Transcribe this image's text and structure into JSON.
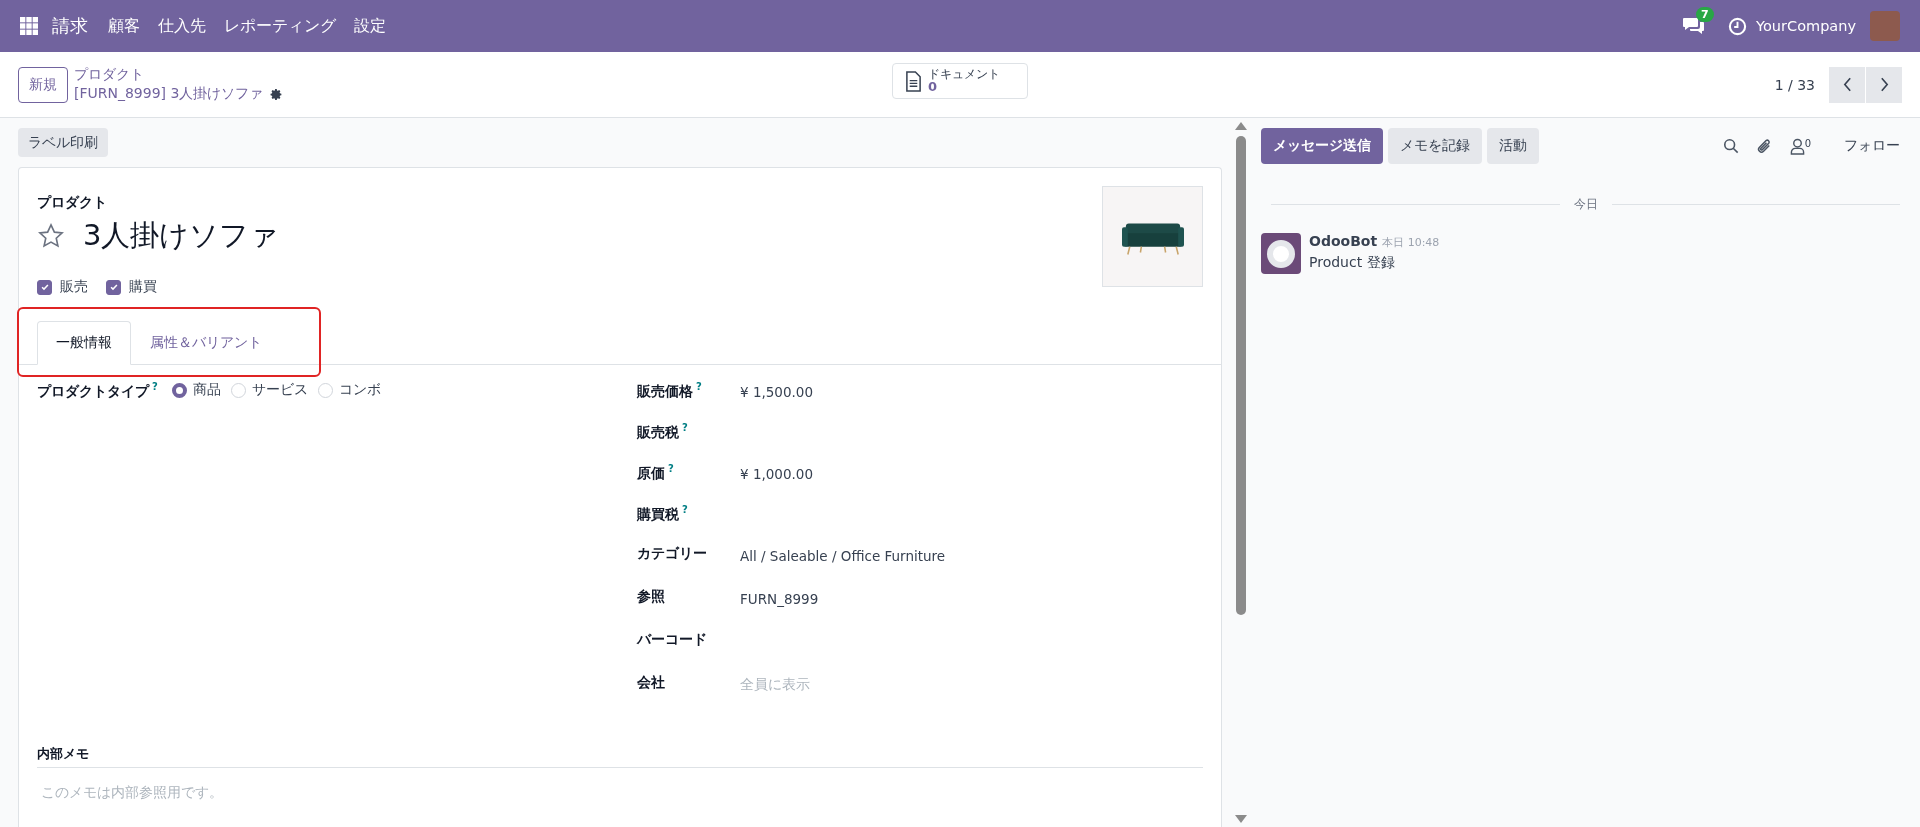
{
  "navbar": {
    "app": "請求",
    "menu": [
      "顧客",
      "仕入先",
      "レポーティング",
      "設定"
    ],
    "message_count": "7",
    "company": "YourCompany"
  },
  "control_panel": {
    "new_button": "新規",
    "breadcrumb": "プロダクト",
    "record": "[FURN_8999] 3人掛けソファ",
    "documents": {
      "label": "ドキュメント",
      "count": "0"
    },
    "pager": "1 / 33"
  },
  "actions": [
    "ラベル印刷"
  ],
  "form": {
    "caption": "プロダクト",
    "name": "3人掛けソファ",
    "favorite": false,
    "options": [
      {
        "label": "販売",
        "checked": true
      },
      {
        "label": "購買",
        "checked": true
      }
    ],
    "tabs": [
      {
        "label": "一般情報",
        "selected": true
      },
      {
        "label": "属性＆バリアント",
        "selected": false
      }
    ],
    "product_type": {
      "label": "プロダクトタイプ",
      "help": "?",
      "options": [
        {
          "label": "商品",
          "selected": true
        },
        {
          "label": "サービス",
          "selected": false
        },
        {
          "label": "コンボ",
          "selected": false
        }
      ]
    },
    "fields": [
      {
        "label": "販売価格",
        "help": "?",
        "value": "¥ 1,500.00"
      },
      {
        "label": "販売税",
        "help": "?"
      },
      {
        "label": "原価",
        "help": "?",
        "value": "¥ 1,000.00"
      },
      {
        "label": "購買税",
        "help": "?"
      },
      {
        "label": "カテゴリー",
        "value": "All / Saleable / Office Furniture"
      },
      {
        "label": "参照",
        "value": "FURN_8999"
      },
      {
        "label": "バーコード"
      },
      {
        "label": "会社",
        "placeholder": "全員に表示"
      }
    ],
    "notes": {
      "label": "内部メモ",
      "placeholder": "このメモは内部参照用です。"
    }
  },
  "chatter": {
    "buttons": [
      {
        "label": "メッセージ送信",
        "primary": true
      },
      {
        "label": "メモを記録",
        "primary": false
      },
      {
        "label": "活動",
        "primary": false
      }
    ],
    "follower_count": "0",
    "follow": "フォロー",
    "date_separator": "今日",
    "messages": [
      {
        "author": "OdooBot",
        "time": "本日 10:48",
        "body": "Product 登録"
      }
    ]
  }
}
